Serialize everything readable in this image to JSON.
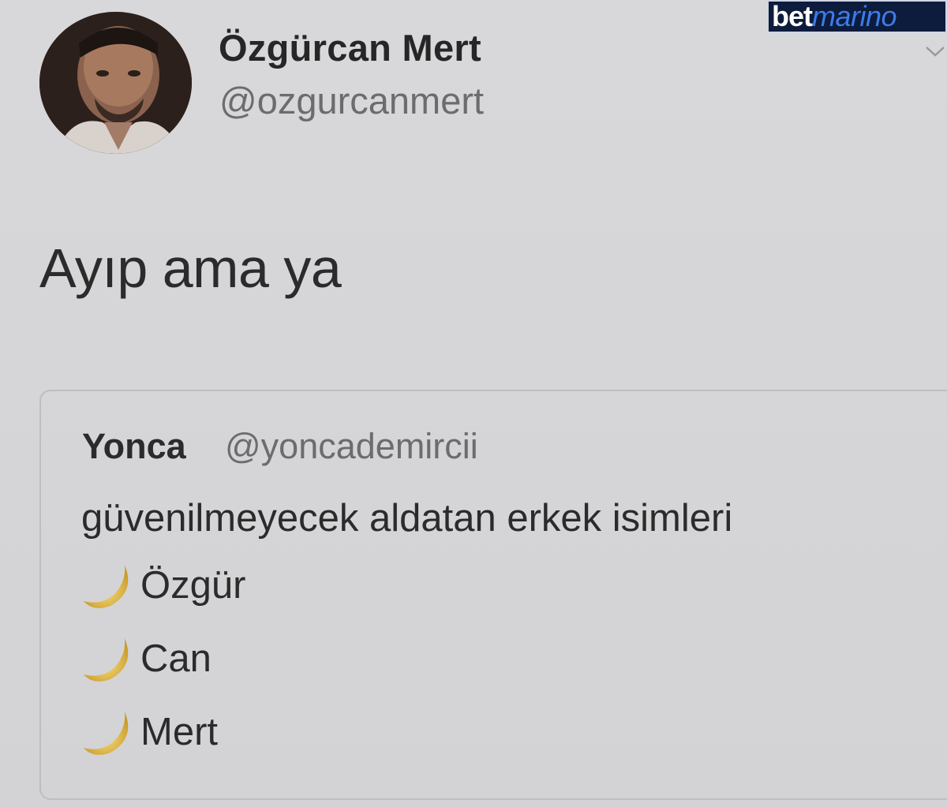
{
  "user": {
    "display_name": "Özgürcan Mert",
    "handle": "@ozgurcanmert"
  },
  "tweet": {
    "text": "Ayıp ama ya"
  },
  "quoted_tweet": {
    "name": "Yonca",
    "handle": "@yoncademircii",
    "text": "güvenilmeyecek aldatan erkek isimleri",
    "list": [
      {
        "icon": "crescent-moon-icon",
        "label": "Özgür"
      },
      {
        "icon": "crescent-moon-icon",
        "label": "Can"
      },
      {
        "icon": "crescent-moon-icon",
        "label": "Mert"
      }
    ]
  },
  "watermark": {
    "part1": "bet",
    "part2": "marino"
  },
  "colors": {
    "background": "#d5d5d7",
    "text": "#2b2b2c",
    "muted": "#6c6c6f",
    "logo_bg": "#0d1b3d",
    "logo_accent": "#3b7ce8",
    "moon": "#e8c04a"
  }
}
